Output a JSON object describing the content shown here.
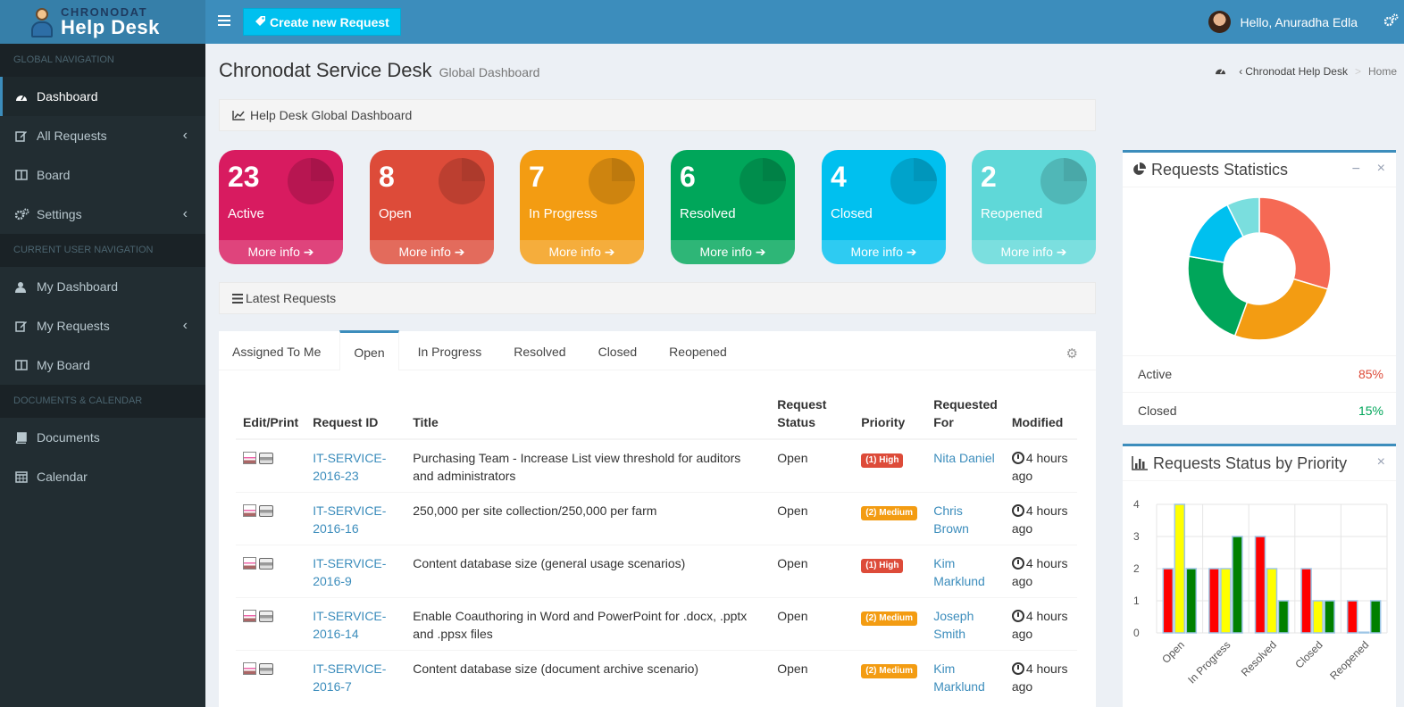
{
  "brand": {
    "top": "CHRONODAT",
    "bottom": "Help Desk"
  },
  "topbar": {
    "create_label": "Create new Request",
    "greeting": "Hello, Anuradha Edla"
  },
  "sidebar": {
    "global_header": "GLOBAL NAVIGATION",
    "global_items": [
      {
        "label": "Dashboard",
        "icon": "dashboard-icon"
      },
      {
        "label": "All Requests",
        "icon": "edit-icon"
      },
      {
        "label": "Board",
        "icon": "columns-icon"
      },
      {
        "label": "Settings",
        "icon": "gears-icon"
      }
    ],
    "user_header": "CURRENT USER NAVIGATION",
    "user_items": [
      {
        "label": "My Dashboard",
        "icon": "user-icon"
      },
      {
        "label": "My Requests",
        "icon": "edit-icon"
      },
      {
        "label": "My Board",
        "icon": "columns-icon"
      }
    ],
    "docs_header": "DOCUMENTS & CALENDAR",
    "docs_items": [
      {
        "label": "Documents",
        "icon": "book-icon"
      },
      {
        "label": "Calendar",
        "icon": "calendar-icon"
      }
    ]
  },
  "page": {
    "title": "Chronodat Service Desk",
    "subtitle": "Global Dashboard",
    "breadcrumb": [
      "Chronodat Help Desk",
      "Home"
    ],
    "dashboard_strip": "Help Desk Global Dashboard",
    "latest_strip": "Latest Requests"
  },
  "boxes": [
    {
      "count": "23",
      "label": "Active",
      "more": "More info",
      "color": "#d81b60"
    },
    {
      "count": "8",
      "label": "Open",
      "more": "More info",
      "color": "#dd4b39"
    },
    {
      "count": "7",
      "label": "In Progress",
      "more": "More info",
      "color": "#f39c12"
    },
    {
      "count": "6",
      "label": "Resolved",
      "more": "More info",
      "color": "#00a65a"
    },
    {
      "count": "4",
      "label": "Closed",
      "more": "More info",
      "color": "#00c0ef"
    },
    {
      "count": "2",
      "label": "Reopened",
      "more": "More info",
      "color": "#5fd8d8"
    }
  ],
  "tabs": [
    "Assigned To Me",
    "Open",
    "In Progress",
    "Resolved",
    "Closed",
    "Reopened"
  ],
  "table": {
    "headers": [
      "Edit/Print",
      "Request ID",
      "Title",
      "Request Status",
      "Priority",
      "Requested For",
      "Modified"
    ],
    "rows": [
      {
        "id": "IT-SERVICE-2016-23",
        "title": "Purchasing Team - Increase List view threshold for auditors and administrators",
        "status": "Open",
        "priority": "(1) High",
        "level": "high",
        "for": "Nita Daniel",
        "modified": "4 hours ago"
      },
      {
        "id": "IT-SERVICE-2016-16",
        "title": "250,000 per site collection/250,000 per farm",
        "status": "Open",
        "priority": "(2) Medium",
        "level": "medium",
        "for": "Chris Brown",
        "modified": "4 hours ago"
      },
      {
        "id": "IT-SERVICE-2016-9",
        "title": "Content database size (general usage scenarios)",
        "status": "Open",
        "priority": "(1) High",
        "level": "high",
        "for": "Kim Marklund",
        "modified": "4 hours ago"
      },
      {
        "id": "IT-SERVICE-2016-14",
        "title": "Enable Coauthoring in Word and PowerPoint for .docx, .pptx and .ppsx files",
        "status": "Open",
        "priority": "(2) Medium",
        "level": "medium",
        "for": "Joseph Smith",
        "modified": "4 hours ago"
      },
      {
        "id": "IT-SERVICE-2016-7",
        "title": "Content database size (document archive scenario)",
        "status": "Open",
        "priority": "(2) Medium",
        "level": "medium",
        "for": "Kim Marklund",
        "modified": "4 hours ago"
      }
    ]
  },
  "stats": {
    "title": "Requests Statistics",
    "rows": [
      {
        "label": "Active",
        "value": "85%",
        "color": "#dd4b39"
      },
      {
        "label": "Closed",
        "value": "15%",
        "color": "#00a65a"
      }
    ]
  },
  "priority_title": "Requests Status by Priority",
  "chart_data": [
    {
      "type": "pie",
      "categories": [
        "Open",
        "In Progress",
        "Resolved",
        "Closed",
        "Reopened"
      ],
      "values": [
        8,
        7,
        6,
        4,
        2
      ],
      "colors": [
        "#f56954",
        "#f39c12",
        "#00a65a",
        "#00c0ef",
        "#7adede"
      ],
      "donut": true
    },
    {
      "type": "bar",
      "categories": [
        "Open",
        "In Progress",
        "Resolved",
        "Closed",
        "Reopened"
      ],
      "series": [
        {
          "values": [
            2,
            2,
            3,
            2,
            1
          ],
          "color": "#ff0000"
        },
        {
          "values": [
            4,
            2,
            2,
            1,
            0
          ],
          "color": "#ffff00"
        },
        {
          "values": [
            2,
            3,
            1,
            1,
            1
          ],
          "color": "#008000"
        }
      ],
      "ylim": [
        0,
        4
      ],
      "yticks": [
        "0",
        "1",
        "2",
        "3",
        "4"
      ],
      "grid": true
    }
  ]
}
